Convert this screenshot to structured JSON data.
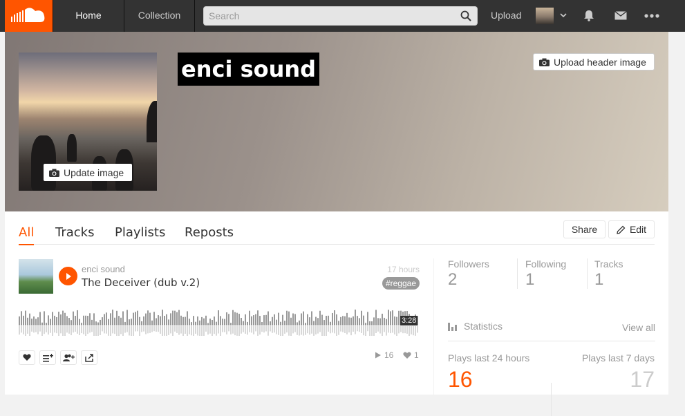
{
  "nav": {
    "home": "Home",
    "collection": "Collection",
    "search_placeholder": "Search",
    "upload": "Upload"
  },
  "header": {
    "username": "enci sound",
    "update_image": "Update image",
    "upload_header": "Upload header image"
  },
  "tabs": [
    {
      "label": "All",
      "active": true
    },
    {
      "label": "Tracks"
    },
    {
      "label": "Playlists"
    },
    {
      "label": "Reposts"
    }
  ],
  "actions": {
    "share": "Share",
    "edit": "Edit"
  },
  "track": {
    "uploader": "enci sound",
    "title": "The Deceiver (dub v.2)",
    "age": "17 hours",
    "tag": "#reggae",
    "duration": "3:28",
    "plays": "16",
    "likes": "1"
  },
  "counts": [
    {
      "label": "Followers",
      "value": "2"
    },
    {
      "label": "Following",
      "value": "1"
    },
    {
      "label": "Tracks",
      "value": "1"
    }
  ],
  "statistics": {
    "title": "Statistics",
    "view_all": "View all",
    "last_24h_label": "Plays last 24 hours",
    "last_24h_value": "16",
    "last_7d_label": "Plays last 7 days",
    "last_7d_value": "17"
  },
  "colors": {
    "accent": "#ff5500",
    "topbar": "#333333"
  }
}
